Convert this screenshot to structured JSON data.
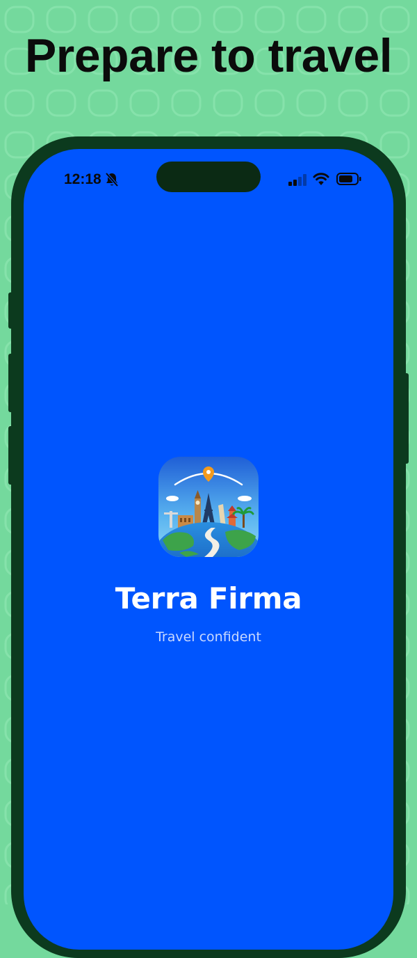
{
  "headline": "Prepare to travel",
  "status_bar": {
    "time": "12:18",
    "icons": [
      "bell-slash-icon",
      "cellular-signal-icon",
      "wifi-icon",
      "battery-icon"
    ]
  },
  "splash": {
    "app_icon": "terra-firma-app-icon",
    "app_name": "Terra Firma",
    "tagline": "Travel confident"
  },
  "colors": {
    "background": "#74d99d",
    "phone_frame": "#0c3a1e",
    "screen": "#0055fe",
    "headline_text": "#0b0b0b",
    "app_name_text": "#ffffff",
    "tagline_text": "#c9d9ff"
  }
}
